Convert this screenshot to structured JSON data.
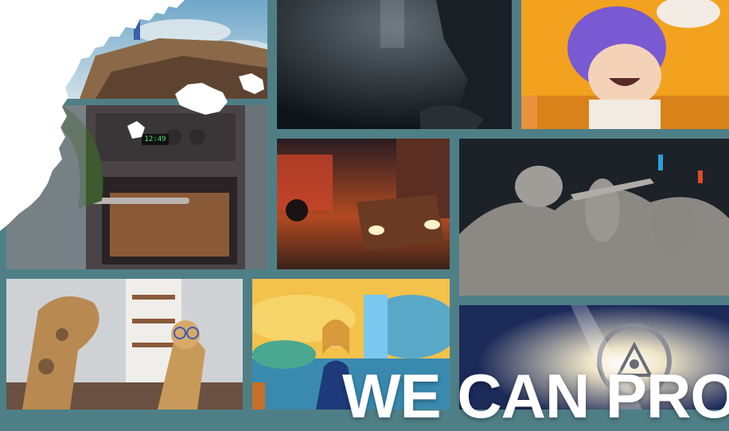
{
  "hero": {
    "headline": "WE CAN PRO"
  },
  "oven_display": "12:49",
  "gallery": [
    {
      "icon": "cliff-landscape-image"
    },
    {
      "icon": "dark-cave-image"
    },
    {
      "icon": "purple-hair-character-image"
    },
    {
      "icon": "oven-creature-image"
    },
    {
      "icon": "night-city-car-image"
    },
    {
      "icon": "clay-sculpture-image"
    },
    {
      "icon": "giraffes-living-room-image"
    },
    {
      "icon": "cartoon-presenter-image"
    },
    {
      "icon": "lantern-glow-image"
    }
  ],
  "colors": {
    "background": "#4f7f86",
    "headline": "#ffffff"
  }
}
